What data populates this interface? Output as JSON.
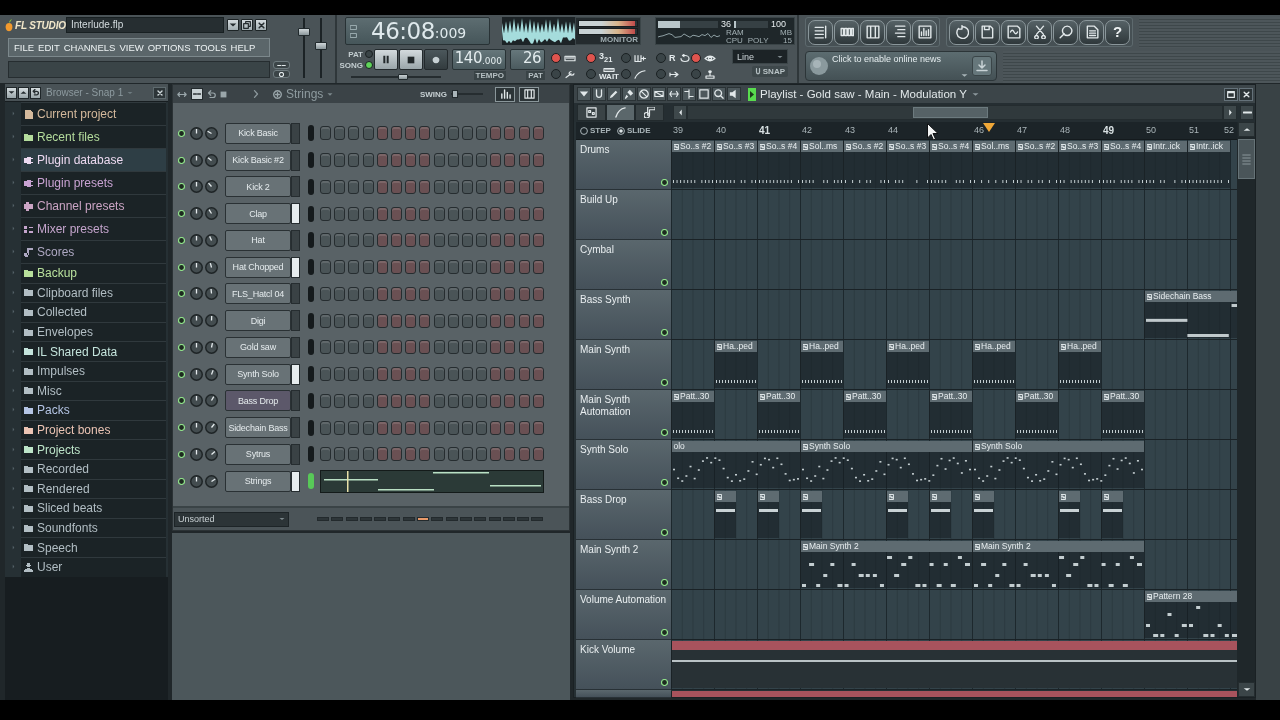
{
  "header": {
    "logo": "FL STUDIO",
    "file_name": "Interlude.flp"
  },
  "menu": [
    "FILE",
    "EDIT",
    "CHANNELS",
    "VIEW",
    "OPTIONS",
    "TOOLS",
    "HELP"
  ],
  "hint_buttons": [
    {
      "on": false
    },
    {
      "on": false
    }
  ],
  "faders": [
    {
      "level": 0.8
    },
    {
      "level": 0.53
    }
  ],
  "transport": {
    "time": {
      "main": "46:08",
      "fraction": ":009"
    },
    "modes": [
      {
        "label": "PAT",
        "selected": false
      },
      {
        "label": "SONG",
        "selected": true
      }
    ],
    "slider": {
      "level": 0.59
    },
    "tempo": {
      "main": "140",
      "fraction": ".000",
      "label": "TEMPO"
    },
    "pattern": {
      "value": "26",
      "label": "PAT"
    }
  },
  "monitor": {
    "label": "MONITOR",
    "meters": [
      {
        "level": 0.97
      },
      {
        "level": 0.97
      }
    ]
  },
  "performance": {
    "cpu": {
      "value": "36",
      "level": 0.36,
      "label": "CPU"
    },
    "ram": {
      "value": "100",
      "unit": "MB",
      "level": 0.05,
      "label": "RAM"
    },
    "poly": {
      "value": "15",
      "label": "POLY"
    }
  },
  "toggles": [
    {
      "on": true
    },
    {
      "on": true,
      "label": "3$_{21}$"
    },
    {
      "on": false
    },
    {
      "on": false,
      "label": "R"
    },
    {
      "on": true
    },
    {
      "on": false
    },
    {
      "on": false,
      "label": "WAIT"
    },
    {
      "on": false
    },
    {
      "on": false
    },
    {
      "on": false
    }
  ],
  "snap": {
    "value": "Line",
    "label": "SNAP"
  },
  "help_button": {
    "label": "?"
  },
  "news": {
    "text": "Click to enable online news"
  },
  "browser": {
    "title": "Browser - Snap 1",
    "items": [
      {
        "label": "Current project",
        "kind": "library",
        "color": "#d4b99c",
        "selected": false
      },
      {
        "label": "Recent files",
        "kind": "library",
        "color": "#b4dc9c",
        "selected": false
      },
      {
        "label": "Plugin database",
        "kind": "library",
        "color": "#ecd9f0",
        "selected": true
      },
      {
        "label": "Plugin presets",
        "kind": "library",
        "color": "#c8a2d2",
        "selected": false
      },
      {
        "label": "Channel presets",
        "kind": "library",
        "color": "#cba4c4",
        "selected": false
      },
      {
        "label": "Mixer presets",
        "kind": "library",
        "color": "#c4a4cc",
        "selected": false
      },
      {
        "label": "Scores",
        "kind": "library",
        "color": "#aea8c2",
        "selected": false
      },
      {
        "label": "Backup",
        "kind": "folder",
        "color": "#b8e09c",
        "selected": false
      },
      {
        "label": "Clipboard files",
        "kind": "folder",
        "color": "#b2bec4",
        "selected": false
      },
      {
        "label": "Collected",
        "kind": "folder",
        "color": "#b2bec4",
        "selected": false
      },
      {
        "label": "Envelopes",
        "kind": "folder",
        "color": "#b2bec4",
        "selected": false
      },
      {
        "label": "IL Shared Data",
        "kind": "folder",
        "color": "#c4e4dc",
        "selected": false
      },
      {
        "label": "Impulses",
        "kind": "folder",
        "color": "#b2bec4",
        "selected": false
      },
      {
        "label": "Misc",
        "kind": "folder",
        "color": "#b2bec4",
        "selected": false
      },
      {
        "label": "Packs",
        "kind": "folder",
        "color": "#b4c4e4",
        "selected": false
      },
      {
        "label": "Project bones",
        "kind": "folder",
        "color": "#ecc4b4",
        "selected": false
      },
      {
        "label": "Projects",
        "kind": "folder",
        "color": "#bce4c8",
        "selected": false
      },
      {
        "label": "Recorded",
        "kind": "folder",
        "color": "#b2bec4",
        "selected": false
      },
      {
        "label": "Rendered",
        "kind": "folder",
        "color": "#b2bec4",
        "selected": false
      },
      {
        "label": "Sliced beats",
        "kind": "folder",
        "color": "#b2bec4",
        "selected": false
      },
      {
        "label": "Soundfonts",
        "kind": "folder",
        "color": "#b2bec4",
        "selected": false
      },
      {
        "label": "Speech",
        "kind": "folder",
        "color": "#b2bec4",
        "selected": false
      },
      {
        "label": "User",
        "kind": "folder",
        "color": "#b2bec4",
        "selected": false
      }
    ]
  },
  "channel_rack": {
    "title": "Strings",
    "swing_label": "SWING",
    "swing": {
      "level": 0.05
    },
    "channels": [
      {
        "name": "Kick Basic",
        "kind": "steps",
        "color": "#687276",
        "selected": false,
        "active": false
      },
      {
        "name": "Kick Basic #2",
        "kind": "steps",
        "color": "#687276",
        "selected": false,
        "active": false
      },
      {
        "name": "Kick 2",
        "kind": "steps",
        "color": "#687276",
        "selected": false,
        "active": false
      },
      {
        "name": "Clap",
        "kind": "steps",
        "color": "#687276",
        "selected": true,
        "active": false
      },
      {
        "name": "Hat",
        "kind": "steps",
        "color": "#687276",
        "selected": false,
        "active": false
      },
      {
        "name": "Hat Chopped",
        "kind": "steps",
        "color": "#687276",
        "selected": true,
        "active": false
      },
      {
        "name": "FLS_Hatcl 04",
        "kind": "steps",
        "color": "#687276",
        "selected": false,
        "active": false
      },
      {
        "name": "Digi",
        "kind": "steps",
        "color": "#687276",
        "selected": false,
        "active": false
      },
      {
        "name": "Gold saw",
        "kind": "steps",
        "color": "#687276",
        "selected": false,
        "active": false
      },
      {
        "name": "Synth Solo",
        "kind": "steps",
        "color": "#687276",
        "selected": true,
        "active": false
      },
      {
        "name": "Bass Drop",
        "kind": "steps",
        "color": "#5c586a",
        "selected": false,
        "active": false
      },
      {
        "name": "Sidechain Bass",
        "kind": "steps",
        "color": "#687276",
        "selected": false,
        "active": false
      },
      {
        "name": "Sytrus",
        "kind": "steps",
        "color": "#687276",
        "selected": false,
        "active": false
      },
      {
        "name": "Strings",
        "kind": "pianoroll",
        "color": "#687276",
        "selected": true,
        "active": true
      }
    ],
    "filter": "Unsorted",
    "pages": [
      {
        "selected": false
      },
      {
        "selected": false
      },
      {
        "selected": false
      },
      {
        "selected": false
      },
      {
        "selected": false
      },
      {
        "selected": false
      },
      {
        "selected": false
      },
      {
        "selected": true
      },
      {
        "selected": false
      },
      {
        "selected": false
      },
      {
        "selected": false
      },
      {
        "selected": false
      },
      {
        "selected": false
      },
      {
        "selected": false
      },
      {
        "selected": false
      },
      {
        "selected": false
      }
    ]
  },
  "playlist": {
    "title": "Playlist - Gold saw - Main - Modulation Y",
    "view_tabs": [
      {
        "selected": false
      },
      {
        "selected": true
      },
      {
        "selected": false
      }
    ],
    "snap_modes": [
      {
        "label": "STEP",
        "selected": false
      },
      {
        "label": "SLIDE",
        "selected": true
      }
    ],
    "bars": [
      "39",
      "40",
      "41",
      "42",
      "43",
      "44",
      "46",
      "47",
      "48",
      "49",
      "50",
      "51",
      "52"
    ],
    "tracks": [
      {
        "name": "Drums",
        "clips": [
          {
            "kind": "pattern",
            "label": "So..s #2"
          },
          {
            "kind": "pattern",
            "label": "So..s #3"
          },
          {
            "kind": "pattern",
            "label": "So..s #4"
          },
          {
            "kind": "pattern",
            "label": "Sol..ms"
          },
          {
            "kind": "pattern",
            "label": "So..s #2"
          },
          {
            "kind": "pattern",
            "label": "So..s #3"
          },
          {
            "kind": "pattern",
            "label": "So..s #4"
          },
          {
            "kind": "pattern",
            "label": "Sol..ms"
          },
          {
            "kind": "pattern",
            "label": "So..s #2"
          },
          {
            "kind": "pattern",
            "label": "So..s #3"
          },
          {
            "kind": "pattern",
            "label": "So..s #4"
          },
          {
            "kind": "pattern",
            "label": "Intr..ick"
          },
          {
            "kind": "pattern",
            "label": "Intr..ick"
          }
        ]
      },
      {
        "name": "Build Up"
      },
      {
        "name": "Cymbal"
      },
      {
        "name": "Bass Synth",
        "clips": [
          {
            "kind": "pattern",
            "label": "Sidechain Bass"
          }
        ]
      },
      {
        "name": "Main Synth",
        "clips": [
          {
            "kind": "pattern",
            "label": "Ha..ped"
          },
          {
            "kind": "pattern",
            "label": "Ha..ped"
          },
          {
            "kind": "pattern",
            "label": "Ha..ped"
          },
          {
            "kind": "pattern",
            "label": "Ha..ped"
          },
          {
            "kind": "pattern",
            "label": "Ha..ped"
          }
        ]
      },
      {
        "name": "Main Synth Automation",
        "clips": [
          {
            "kind": "pattern",
            "label": "Patt..30"
          },
          {
            "kind": "pattern",
            "label": "Patt..30"
          },
          {
            "kind": "pattern",
            "label": "Patt..30"
          },
          {
            "kind": "pattern",
            "label": "Patt..30"
          },
          {
            "kind": "pattern",
            "label": "Patt..30"
          },
          {
            "kind": "pattern",
            "label": "Patt..30"
          }
        ]
      },
      {
        "name": "Synth Solo",
        "clips": [
          {
            "kind": "pattern",
            "label": "olo"
          },
          {
            "kind": "pattern",
            "label": "Synth Solo"
          },
          {
            "kind": "pattern",
            "label": "Synth Solo"
          }
        ]
      },
      {
        "name": "Bass Drop",
        "clips": [
          {
            "kind": "pattern"
          },
          {
            "kind": "pattern"
          },
          {
            "kind": "pattern"
          },
          {
            "kind": "pattern"
          },
          {
            "kind": "pattern"
          },
          {
            "kind": "pattern"
          },
          {
            "kind": "pattern"
          },
          {
            "kind": "pattern"
          }
        ]
      },
      {
        "name": "Main Synth 2",
        "clips": [
          {
            "kind": "pattern",
            "label": "Main Synth 2"
          },
          {
            "kind": "pattern",
            "label": "Main Synth 2"
          }
        ]
      },
      {
        "name": "Volume Automation",
        "clips": [
          {
            "kind": "pattern",
            "label": "Pattern 28"
          }
        ]
      },
      {
        "name": "Kick Volume",
        "clips": [
          {
            "kind": "automation"
          }
        ]
      },
      {
        "clips": [
          {
            "kind": "automation"
          }
        ]
      }
    ]
  }
}
